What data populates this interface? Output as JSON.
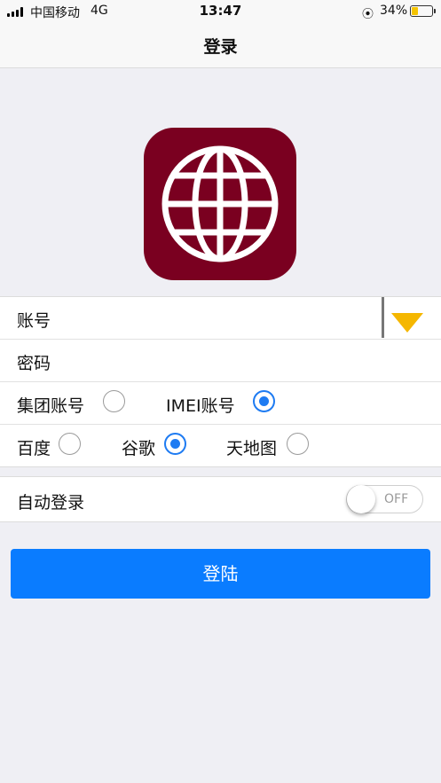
{
  "status": {
    "carrier": "中国移动",
    "network": "4G",
    "time": "13:47",
    "battery_percent": "34%",
    "battery_level": 0.34
  },
  "nav": {
    "title": "登录"
  },
  "logo": {
    "icon": "globe-icon",
    "color": "#7a0020"
  },
  "form": {
    "account_label": "账号",
    "password_label": "密码",
    "account_type": {
      "options": [
        {
          "label": "集团账号",
          "selected": false
        },
        {
          "label": "IMEI账号",
          "selected": true
        }
      ]
    },
    "map_source": {
      "options": [
        {
          "label": "百度",
          "selected": false
        },
        {
          "label": "谷歌",
          "selected": true
        },
        {
          "label": "天地图",
          "selected": false
        }
      ]
    },
    "dropdown_icon": "triangle-down-icon",
    "dropdown_color": "#f5b700"
  },
  "auto_login": {
    "label": "自动登录",
    "toggle_text": "OFF",
    "enabled": false
  },
  "login_button": {
    "label": "登陆",
    "color": "#0a7cff"
  },
  "accent_color": "#1e7bf2"
}
